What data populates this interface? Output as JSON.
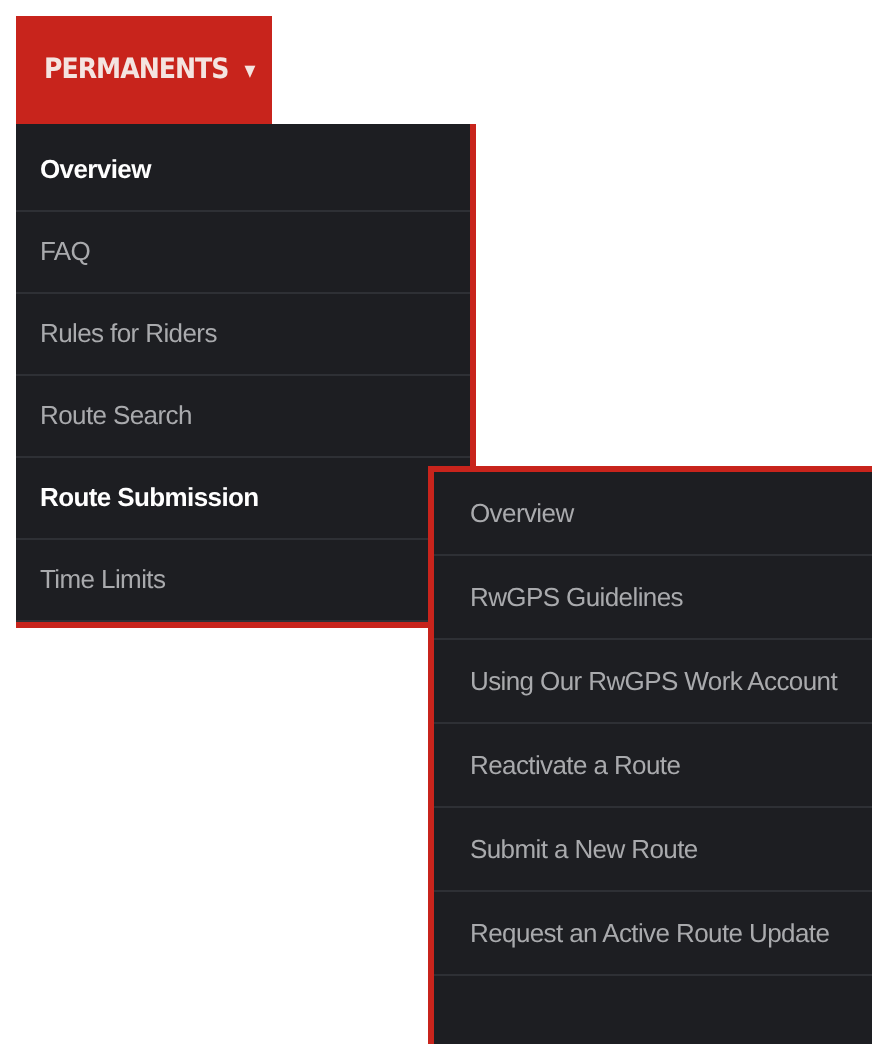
{
  "menu_button": {
    "label": "PERMANENTS",
    "caret": "▾",
    "expanded": true
  },
  "menu_items": [
    {
      "label": "Overview",
      "selected": true,
      "expanded": false
    },
    {
      "label": "FAQ",
      "selected": false,
      "expanded": false
    },
    {
      "label": "Rules for Riders",
      "selected": false,
      "expanded": false
    },
    {
      "label": "Route Search",
      "selected": false,
      "expanded": false
    },
    {
      "label": "Route Submission",
      "selected": false,
      "expanded": true,
      "children": [
        {
          "label": "Overview"
        },
        {
          "label": "RwGPS Guidelines"
        },
        {
          "label": "Using Our RwGPS Work Account"
        },
        {
          "label": "Reactivate a Route"
        },
        {
          "label": "Submit a New Route"
        },
        {
          "label": "Request an Active Route Update"
        }
      ]
    },
    {
      "label": "Time Limits",
      "selected": false,
      "expanded": false
    }
  ]
}
